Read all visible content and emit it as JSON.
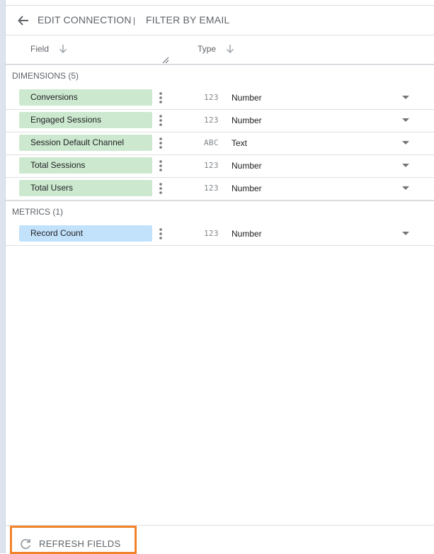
{
  "toolbar": {
    "edit_connection": "EDIT CONNECTION",
    "separator": "|",
    "filter_by_email": "FILTER BY EMAIL"
  },
  "columns": {
    "field": "Field",
    "type": "Type"
  },
  "dimensions": {
    "label": "DIMENSIONS (5)",
    "items": [
      {
        "name": "Conversions",
        "type_icon": "123",
        "type": "Number"
      },
      {
        "name": "Engaged Sessions",
        "type_icon": "123",
        "type": "Number"
      },
      {
        "name": "Session Default Channel",
        "type_icon": "ABC",
        "type": "Text"
      },
      {
        "name": "Total Sessions",
        "type_icon": "123",
        "type": "Number"
      },
      {
        "name": "Total Users",
        "type_icon": "123",
        "type": "Number"
      }
    ]
  },
  "metrics": {
    "label": "METRICS (1)",
    "items": [
      {
        "name": "Record Count",
        "type_icon": "123",
        "type": "Number"
      }
    ]
  },
  "footer": {
    "refresh_label": "REFRESH FIELDS"
  },
  "colors": {
    "dimension_chip": "#cce9cf",
    "metric_chip": "#c2e2fb",
    "highlight_border": "#f0832b"
  }
}
